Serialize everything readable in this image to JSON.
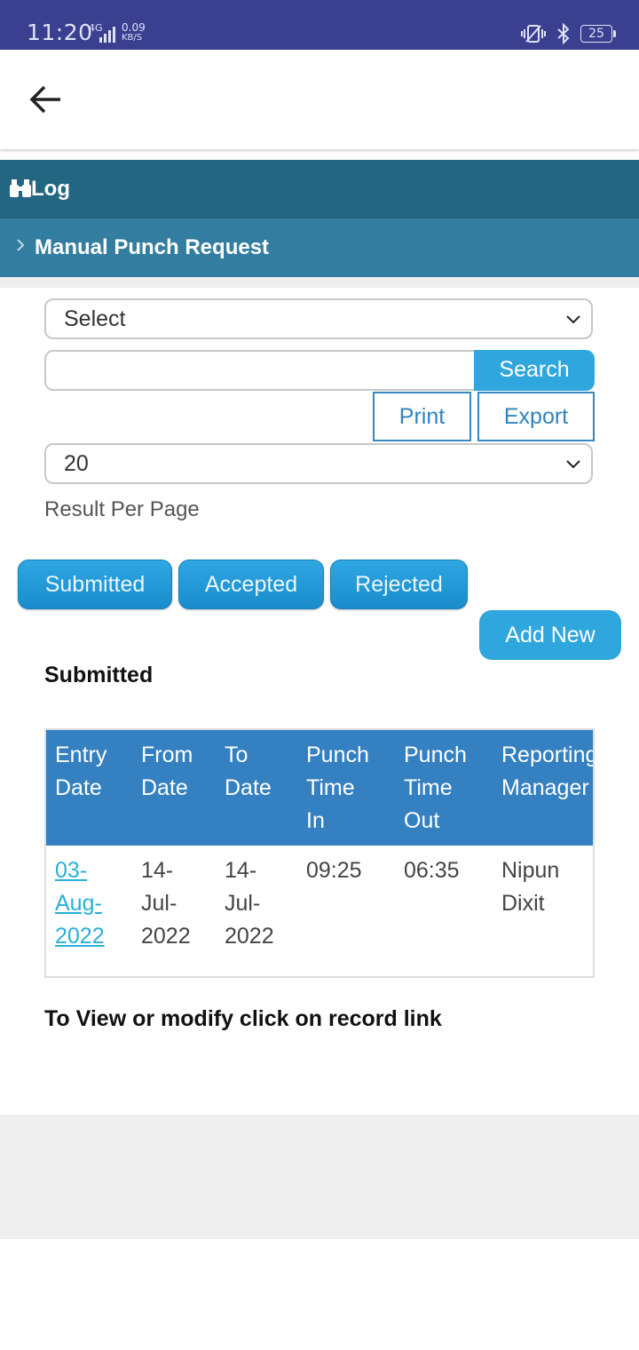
{
  "status_bar": {
    "time": "11:20",
    "network": "4G",
    "speed_value": "0.09",
    "speed_unit": "KB/S",
    "battery": "25",
    "icons": [
      "vibrate-icon",
      "bluetooth-icon",
      "battery-icon"
    ]
  },
  "app_bar": {
    "back_icon": "arrow-left-icon"
  },
  "header": {
    "title": "Log",
    "icon": "binoculars-icon"
  },
  "sub_header": {
    "title": "Manual Punch Request",
    "icon": "chevron-right-icon"
  },
  "filters": {
    "filter_select": "Select",
    "search_value": "",
    "search_label": "Search",
    "print_label": "Print",
    "export_label": "Export",
    "page_size": "20",
    "page_size_label": "Result Per Page"
  },
  "tabs": [
    {
      "label": "Submitted"
    },
    {
      "label": "Accepted"
    },
    {
      "label": "Rejected"
    }
  ],
  "add_new_label": "Add New",
  "section_title": "Submitted",
  "table": {
    "headers": [
      [
        "Entry",
        "Date"
      ],
      [
        "From",
        "Date"
      ],
      [
        "To",
        "Date"
      ],
      [
        "Punch",
        "Time",
        "In"
      ],
      [
        "Punch",
        "Time",
        "Out"
      ],
      [
        "Reporting",
        "Manager"
      ]
    ],
    "rows": [
      {
        "entry_date": [
          "03-",
          "Aug-",
          "2022"
        ],
        "from_date": [
          "14-",
          "Jul-",
          "2022"
        ],
        "to_date": [
          "14-",
          "Jul-",
          "2022"
        ],
        "punch_in": "09:25",
        "punch_out": "06:35",
        "manager": [
          "Nipun",
          "Dixit"
        ]
      }
    ]
  },
  "footer_note": "To View or modify click on record link",
  "colors": {
    "status_bar": "#3a3f8f",
    "header": "#236681",
    "sub_header": "#337ea0",
    "primary_button": "#2fa6dd",
    "table_header": "#3580c0",
    "link": "#28b0d8"
  }
}
